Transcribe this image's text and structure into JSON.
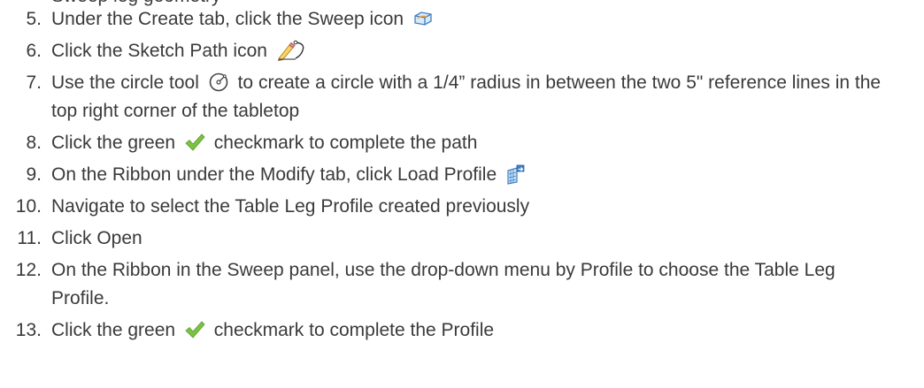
{
  "clipped_line": "Sweep leg geometry",
  "steps": [
    {
      "number": "5.",
      "before": "Under the Create tab, click the Sweep icon",
      "after": ""
    },
    {
      "number": "6.",
      "before": "Click the Sketch Path icon",
      "after": ""
    },
    {
      "number": "7.",
      "before": "Use the circle tool",
      "after": "to create a circle with a 1/4” radius in between the two 5\" reference lines in the top right corner of the tabletop"
    },
    {
      "number": "8.",
      "before": "Click the green",
      "after": "checkmark to complete the path"
    },
    {
      "number": "9.",
      "before": "On the Ribbon under the Modify tab, click Load Profile",
      "after": ""
    },
    {
      "number": "10.",
      "before": "Navigate to select the Table Leg Profile created previously",
      "after": ""
    },
    {
      "number": "11.",
      "before": "Click Open",
      "after": ""
    },
    {
      "number": "12.",
      "before": "On the Ribbon in the Sweep panel, use the drop-down menu by Profile to choose the Table Leg Profile.",
      "after": ""
    },
    {
      "number": "13.",
      "before": "Click the green",
      "after": "checkmark to complete the Profile"
    }
  ],
  "colors": {
    "text": "#3a3a3a",
    "checkmark": "#7cc242",
    "icon_blue": "#3d7fc4"
  },
  "icons": {
    "sweep": "sweep-icon",
    "sketch_path": "sketch-path-icon",
    "circle_tool": "circle-tool-icon",
    "checkmark": "green-checkmark-icon",
    "load_profile": "load-profile-icon"
  }
}
